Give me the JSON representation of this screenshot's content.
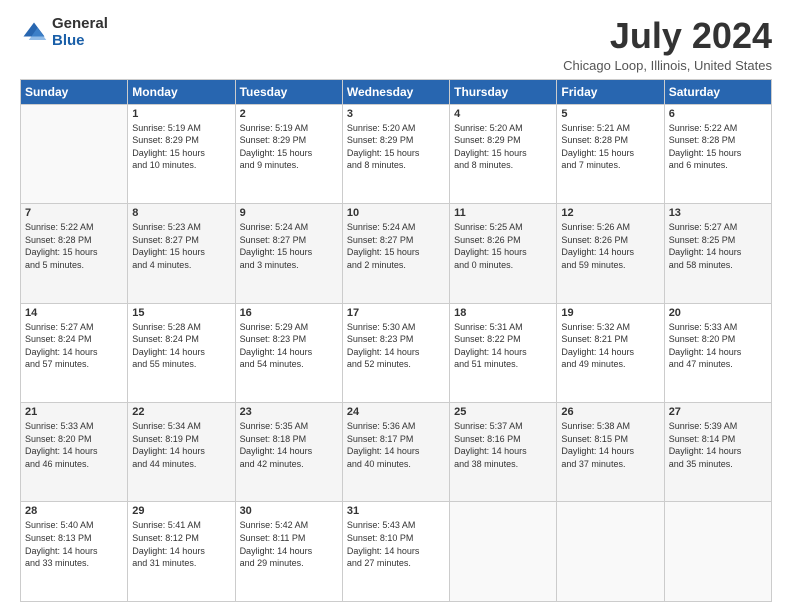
{
  "logo": {
    "general": "General",
    "blue": "Blue"
  },
  "title": "July 2024",
  "location": "Chicago Loop, Illinois, United States",
  "days_header": [
    "Sunday",
    "Monday",
    "Tuesday",
    "Wednesday",
    "Thursday",
    "Friday",
    "Saturday"
  ],
  "weeks": [
    [
      {
        "day": "",
        "info": ""
      },
      {
        "day": "1",
        "info": "Sunrise: 5:19 AM\nSunset: 8:29 PM\nDaylight: 15 hours\nand 10 minutes."
      },
      {
        "day": "2",
        "info": "Sunrise: 5:19 AM\nSunset: 8:29 PM\nDaylight: 15 hours\nand 9 minutes."
      },
      {
        "day": "3",
        "info": "Sunrise: 5:20 AM\nSunset: 8:29 PM\nDaylight: 15 hours\nand 8 minutes."
      },
      {
        "day": "4",
        "info": "Sunrise: 5:20 AM\nSunset: 8:29 PM\nDaylight: 15 hours\nand 8 minutes."
      },
      {
        "day": "5",
        "info": "Sunrise: 5:21 AM\nSunset: 8:28 PM\nDaylight: 15 hours\nand 7 minutes."
      },
      {
        "day": "6",
        "info": "Sunrise: 5:22 AM\nSunset: 8:28 PM\nDaylight: 15 hours\nand 6 minutes."
      }
    ],
    [
      {
        "day": "7",
        "info": "Sunrise: 5:22 AM\nSunset: 8:28 PM\nDaylight: 15 hours\nand 5 minutes."
      },
      {
        "day": "8",
        "info": "Sunrise: 5:23 AM\nSunset: 8:27 PM\nDaylight: 15 hours\nand 4 minutes."
      },
      {
        "day": "9",
        "info": "Sunrise: 5:24 AM\nSunset: 8:27 PM\nDaylight: 15 hours\nand 3 minutes."
      },
      {
        "day": "10",
        "info": "Sunrise: 5:24 AM\nSunset: 8:27 PM\nDaylight: 15 hours\nand 2 minutes."
      },
      {
        "day": "11",
        "info": "Sunrise: 5:25 AM\nSunset: 8:26 PM\nDaylight: 15 hours\nand 0 minutes."
      },
      {
        "day": "12",
        "info": "Sunrise: 5:26 AM\nSunset: 8:26 PM\nDaylight: 14 hours\nand 59 minutes."
      },
      {
        "day": "13",
        "info": "Sunrise: 5:27 AM\nSunset: 8:25 PM\nDaylight: 14 hours\nand 58 minutes."
      }
    ],
    [
      {
        "day": "14",
        "info": "Sunrise: 5:27 AM\nSunset: 8:24 PM\nDaylight: 14 hours\nand 57 minutes."
      },
      {
        "day": "15",
        "info": "Sunrise: 5:28 AM\nSunset: 8:24 PM\nDaylight: 14 hours\nand 55 minutes."
      },
      {
        "day": "16",
        "info": "Sunrise: 5:29 AM\nSunset: 8:23 PM\nDaylight: 14 hours\nand 54 minutes."
      },
      {
        "day": "17",
        "info": "Sunrise: 5:30 AM\nSunset: 8:23 PM\nDaylight: 14 hours\nand 52 minutes."
      },
      {
        "day": "18",
        "info": "Sunrise: 5:31 AM\nSunset: 8:22 PM\nDaylight: 14 hours\nand 51 minutes."
      },
      {
        "day": "19",
        "info": "Sunrise: 5:32 AM\nSunset: 8:21 PM\nDaylight: 14 hours\nand 49 minutes."
      },
      {
        "day": "20",
        "info": "Sunrise: 5:33 AM\nSunset: 8:20 PM\nDaylight: 14 hours\nand 47 minutes."
      }
    ],
    [
      {
        "day": "21",
        "info": "Sunrise: 5:33 AM\nSunset: 8:20 PM\nDaylight: 14 hours\nand 46 minutes."
      },
      {
        "day": "22",
        "info": "Sunrise: 5:34 AM\nSunset: 8:19 PM\nDaylight: 14 hours\nand 44 minutes."
      },
      {
        "day": "23",
        "info": "Sunrise: 5:35 AM\nSunset: 8:18 PM\nDaylight: 14 hours\nand 42 minutes."
      },
      {
        "day": "24",
        "info": "Sunrise: 5:36 AM\nSunset: 8:17 PM\nDaylight: 14 hours\nand 40 minutes."
      },
      {
        "day": "25",
        "info": "Sunrise: 5:37 AM\nSunset: 8:16 PM\nDaylight: 14 hours\nand 38 minutes."
      },
      {
        "day": "26",
        "info": "Sunrise: 5:38 AM\nSunset: 8:15 PM\nDaylight: 14 hours\nand 37 minutes."
      },
      {
        "day": "27",
        "info": "Sunrise: 5:39 AM\nSunset: 8:14 PM\nDaylight: 14 hours\nand 35 minutes."
      }
    ],
    [
      {
        "day": "28",
        "info": "Sunrise: 5:40 AM\nSunset: 8:13 PM\nDaylight: 14 hours\nand 33 minutes."
      },
      {
        "day": "29",
        "info": "Sunrise: 5:41 AM\nSunset: 8:12 PM\nDaylight: 14 hours\nand 31 minutes."
      },
      {
        "day": "30",
        "info": "Sunrise: 5:42 AM\nSunset: 8:11 PM\nDaylight: 14 hours\nand 29 minutes."
      },
      {
        "day": "31",
        "info": "Sunrise: 5:43 AM\nSunset: 8:10 PM\nDaylight: 14 hours\nand 27 minutes."
      },
      {
        "day": "",
        "info": ""
      },
      {
        "day": "",
        "info": ""
      },
      {
        "day": "",
        "info": ""
      }
    ]
  ]
}
